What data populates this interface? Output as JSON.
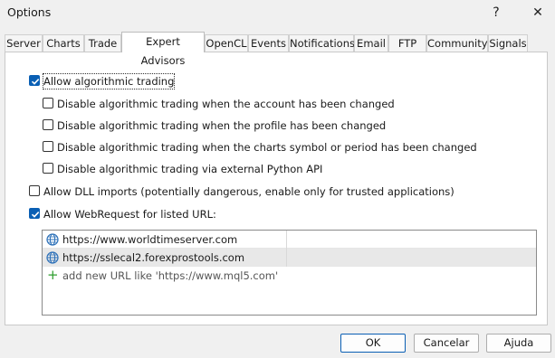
{
  "window": {
    "title": "Options",
    "help_glyph": "?",
    "close_glyph": "✕"
  },
  "tabs": [
    {
      "label": "Server"
    },
    {
      "label": "Charts"
    },
    {
      "label": "Trade"
    },
    {
      "label": "Expert Advisors",
      "active": true
    },
    {
      "label": "OpenCL"
    },
    {
      "label": "Events"
    },
    {
      "label": "Notifications"
    },
    {
      "label": "Email"
    },
    {
      "label": "FTP"
    },
    {
      "label": "Community"
    },
    {
      "label": "Signals"
    }
  ],
  "options": {
    "allow_algo": {
      "label": "Allow algorithmic trading",
      "checked": true
    },
    "disable_account": {
      "label": "Disable algorithmic trading when the account has been changed",
      "checked": false
    },
    "disable_profile": {
      "label": "Disable algorithmic trading when the profile has been changed",
      "checked": false
    },
    "disable_symbol": {
      "label": "Disable algorithmic trading when the charts symbol or period has been changed",
      "checked": false
    },
    "disable_python": {
      "label": "Disable algorithmic trading via external Python API",
      "checked": false
    },
    "allow_dll": {
      "label": "Allow DLL imports (potentially dangerous, enable only for trusted applications)",
      "checked": false
    },
    "allow_webrequest": {
      "label": "Allow WebRequest for listed URL:",
      "checked": true
    }
  },
  "urls": {
    "items": [
      "https://www.worldtimeserver.com",
      "https://sslecal2.forexprostools.com"
    ],
    "add_placeholder": "add new URL like 'https://www.mql5.com'"
  },
  "buttons": {
    "ok": "OK",
    "cancel": "Cancelar",
    "help": "Ajuda"
  },
  "colors": {
    "accent": "#0a5fb4",
    "add_icon": "#2e9e2e"
  }
}
